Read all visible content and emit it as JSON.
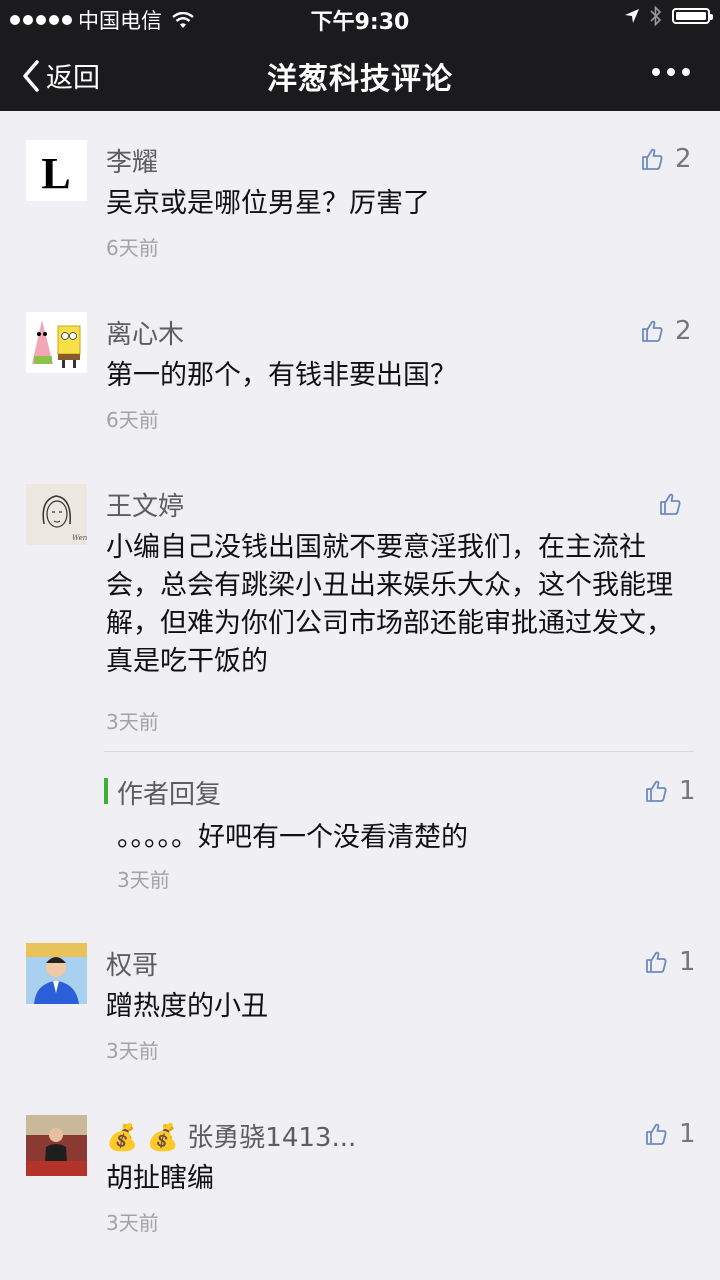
{
  "status": {
    "carrier": "中国电信",
    "time": "下午9:30"
  },
  "nav": {
    "back_label": "返回",
    "title": "洋葱科技评论"
  },
  "comments": [
    {
      "name": "李耀",
      "text": "吴京或是哪位男星？厉害了",
      "time": "6天前",
      "likes": "2"
    },
    {
      "name": "离心木",
      "text": "第一的那个，有钱非要出国？",
      "time": "6天前",
      "likes": "2"
    },
    {
      "name": "王文婷",
      "text": "小编自己没钱出国就不要意淫我们，在主流社会，总会有跳梁小丑出来娱乐大众，这个我能理解，但难为你们公司市场部还能审批通过发文，真是吃干饭的",
      "time": "3天前",
      "likes": "",
      "reply": {
        "label": "作者回复",
        "text": "。。。。。好吧有一个没看清楚的",
        "time": "3天前",
        "likes": "1"
      }
    },
    {
      "name": "权哥",
      "text": "蹭热度的小丑",
      "time": "3天前",
      "likes": "1"
    },
    {
      "name": "💰 💰 张勇骁1413...",
      "text": "胡扯瞎编",
      "time": "3天前",
      "likes": "1"
    }
  ],
  "colors": {
    "topbar": "#1b1b1d",
    "background": "#efeff4",
    "reply_accent": "#3cb034",
    "like_icon": "#6d8bbf"
  }
}
